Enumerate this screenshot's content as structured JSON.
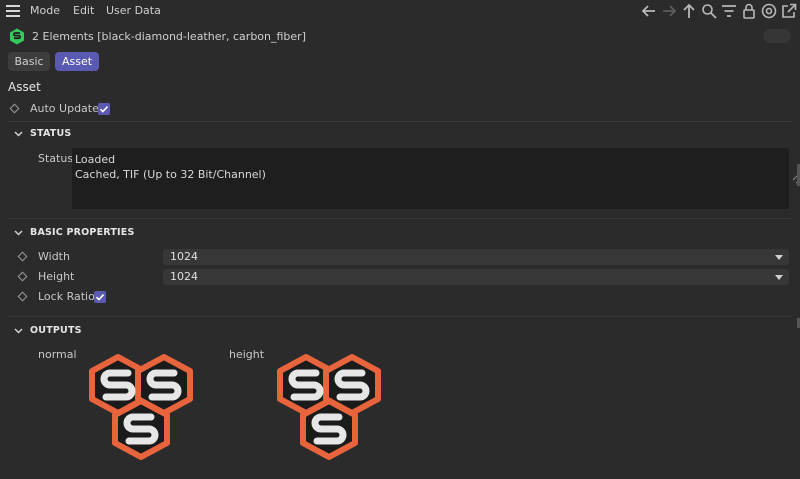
{
  "menubar": {
    "items": [
      "Mode",
      "Edit",
      "User Data"
    ],
    "toolbar_icons": [
      "back-arrow-icon",
      "forward-arrow-icon",
      "up-arrow-icon",
      "search-icon",
      "filter-icon",
      "lock-icon",
      "target-icon",
      "open-external-icon"
    ]
  },
  "header": {
    "title": "2 Elements [black-diamond-leather, carbon_fiber]",
    "logo_icon": "substance-s-icon",
    "accent": "#35c95d"
  },
  "tabs": [
    {
      "label": "Basic",
      "active": false
    },
    {
      "label": "Asset",
      "active": true
    }
  ],
  "section": {
    "title": "Asset"
  },
  "auto_update": {
    "label": "Auto Update",
    "checked": true
  },
  "status_group": {
    "title": "STATUS",
    "field_label": "Status",
    "lines": [
      "Loaded",
      "Cached, TIF (Up to 32 Bit/Channel)"
    ]
  },
  "basic_properties": {
    "title": "BASIC PROPERTIES",
    "width": {
      "label": "Width",
      "value": "1024"
    },
    "height": {
      "label": "Height",
      "value": "1024"
    },
    "lock_ratio": {
      "label": "Lock Ratio",
      "checked": true
    }
  },
  "outputs": {
    "title": "OUTPUTS",
    "items": [
      {
        "label": "normal",
        "icon": "substance-output-icon"
      },
      {
        "label": "height",
        "icon": "substance-output-icon"
      }
    ]
  },
  "colors": {
    "accent_purple": "#5a5ab3",
    "orange": "#e8643c",
    "background": "#2b2b2b"
  }
}
